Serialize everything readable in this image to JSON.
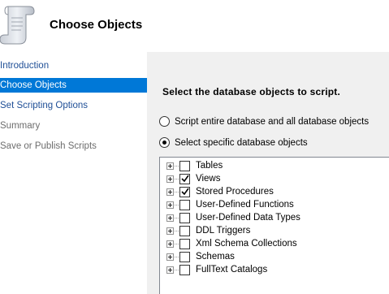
{
  "header": {
    "title": "Choose Objects",
    "icon": "scroll-icon"
  },
  "sidebar": {
    "items": [
      {
        "label": "Introduction",
        "state": "link"
      },
      {
        "label": "Choose Objects",
        "state": "selected"
      },
      {
        "label": "Set Scripting Options",
        "state": "link"
      },
      {
        "label": "Summary",
        "state": "disabled"
      },
      {
        "label": "Save or Publish Scripts",
        "state": "disabled"
      }
    ]
  },
  "main": {
    "heading": "Select the database objects to script.",
    "radio_options": [
      {
        "label": "Script entire database and all database objects",
        "selected": false
      },
      {
        "label": "Select specific database objects",
        "selected": true
      }
    ],
    "tree": [
      {
        "label": "Tables",
        "checked": false
      },
      {
        "label": "Views",
        "checked": true
      },
      {
        "label": "Stored Procedures",
        "checked": true
      },
      {
        "label": "User-Defined Functions",
        "checked": false
      },
      {
        "label": "User-Defined Data Types",
        "checked": false
      },
      {
        "label": "DDL Triggers",
        "checked": false
      },
      {
        "label": "Xml Schema Collections",
        "checked": false
      },
      {
        "label": "Schemas",
        "checked": false
      },
      {
        "label": "FullText Catalogs",
        "checked": false
      }
    ]
  },
  "colors": {
    "selected_bg": "#0078d7",
    "link": "#1e4e96",
    "disabled": "#6d6d6d",
    "panel_bg": "#f0f0f0"
  }
}
